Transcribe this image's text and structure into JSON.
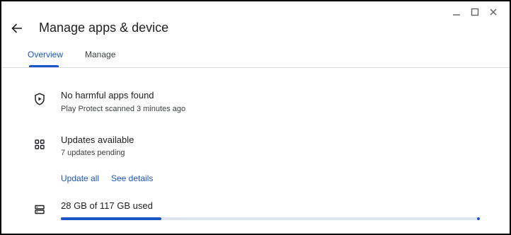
{
  "window": {
    "controls": {
      "minimize_icon": "minimize-icon",
      "maximize_icon": "maximize-icon",
      "close_icon": "close-icon"
    }
  },
  "header": {
    "title": "Manage apps & device",
    "back_icon": "arrow-back-icon"
  },
  "tabs": [
    {
      "label": "Overview",
      "selected": true
    },
    {
      "label": "Manage",
      "selected": false
    }
  ],
  "protect": {
    "icon": "shield-play-icon",
    "title": "No harmful apps found",
    "subtitle": "Play Protect scanned 3 minutes ago"
  },
  "updates": {
    "icon": "apps-grid-icon",
    "title": "Updates available",
    "subtitle": "7 updates pending",
    "update_all_label": "Update all",
    "see_details_label": "See details"
  },
  "storage": {
    "icon": "storage-icon",
    "label": "28 GB of 117 GB used",
    "used_gb": 28,
    "total_gb": 117
  },
  "colors": {
    "accent": "#1a56c8",
    "track": "#dfe6f1",
    "divider": "#dadce0"
  }
}
